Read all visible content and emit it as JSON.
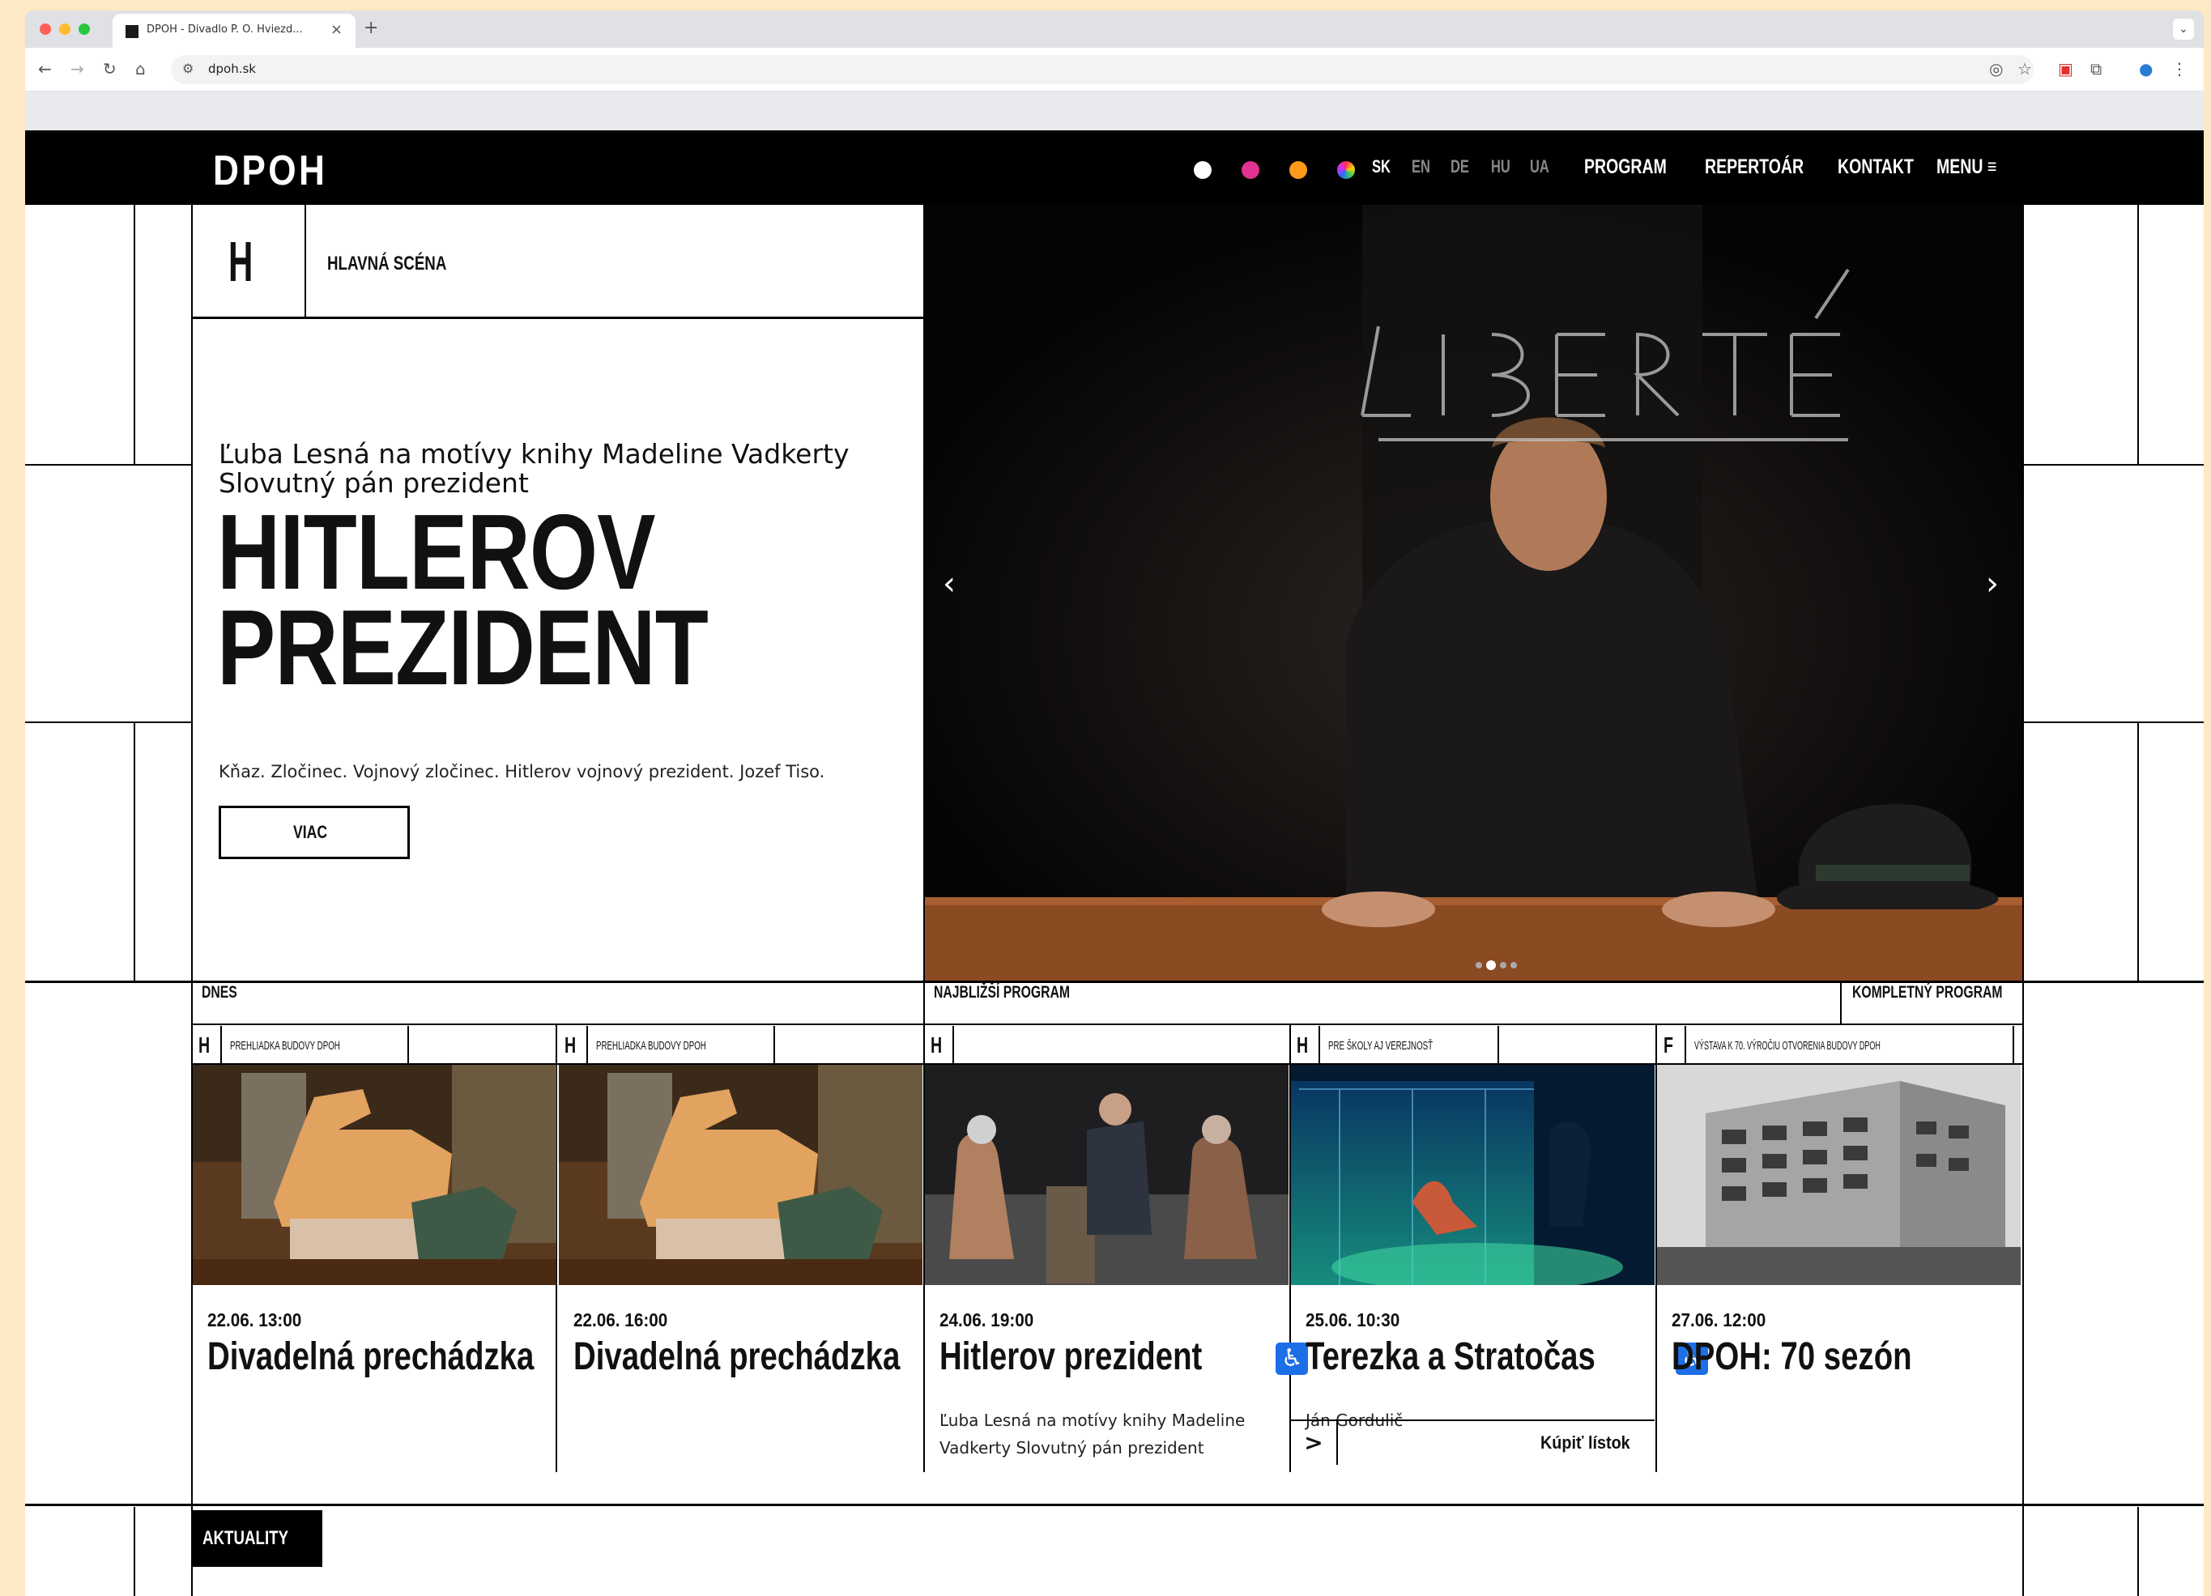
{
  "browser": {
    "tab_title": "DPOH - Divadlo P. O. Hviezd...",
    "url": "dpoh.sk"
  },
  "site": {
    "logo": "DPOH",
    "languages": [
      "SK",
      "EN",
      "DE",
      "HU",
      "UA"
    ],
    "nav": {
      "program": "PROGRAM",
      "repertoar": "REPERTOÁR",
      "kontakt": "KONTAKT",
      "menu": "MENU"
    },
    "colors": {
      "white_dot": "#ffffff",
      "pink_dot": "#e0338f",
      "orange_dot": "#ff9a1a"
    }
  },
  "hero": {
    "stage_icon": "H",
    "stage_label": "HLAVNÁ SCÉNA",
    "subtitle_line1": "Ľuba Lesná na motívy knihy Madeline Vadkerty",
    "subtitle_line2": "Slovutný pán prezident",
    "title_line1": "HITLEROV",
    "title_line2": "PREZIDENT",
    "description": "Kňaz. Zločinec. Vojnový zločinec. Hitlerov vojnový prezident. Jozef Tiso.",
    "more_button": "VIAC",
    "image_text": "LIBERTÉ",
    "slides_total": 4,
    "slide_active": 2
  },
  "program": {
    "today_label": "DNES",
    "upcoming_label": "NAJBLIŽŠÍ PROGRAM",
    "full_program": "KOMPLETNÝ PROGRAM",
    "cards": [
      {
        "icon": "H",
        "tag": "PREHLIADKA BUDOVY DPOH",
        "date": "22.06.  13:00",
        "title": "Divadelná prechádzka"
      },
      {
        "icon": "H",
        "tag": "PREHLIADKA BUDOVY DPOH",
        "date": "22.06.  16:00",
        "title": "Divadelná prechádzka"
      },
      {
        "icon": "H",
        "tag": "",
        "date": "24.06.  19:00",
        "title": "Hitlerov prezident",
        "note": "Ľuba Lesná na motívy knihy Madeline Vadkerty Slovutný pán prezident",
        "accessible": "♿"
      },
      {
        "icon": "H",
        "tag": "PRE ŠKOLY AJ VEREJNOSŤ",
        "date": "25.06.  10:30",
        "title": "Terezka a Stratočas",
        "note": "Ján Gordulič",
        "accessible": "♿",
        "ticket": "Kúpiť lístok",
        "ticket_arrow": ">"
      },
      {
        "icon": "F",
        "tag": "VÝSTAVA K 70. VÝROČIU OTVORENIA BUDOVY DPOH",
        "date": "27.06.  12:00",
        "title": "DPOH: 70 sezón"
      }
    ]
  },
  "news": {
    "label": "AKTUALITY"
  }
}
